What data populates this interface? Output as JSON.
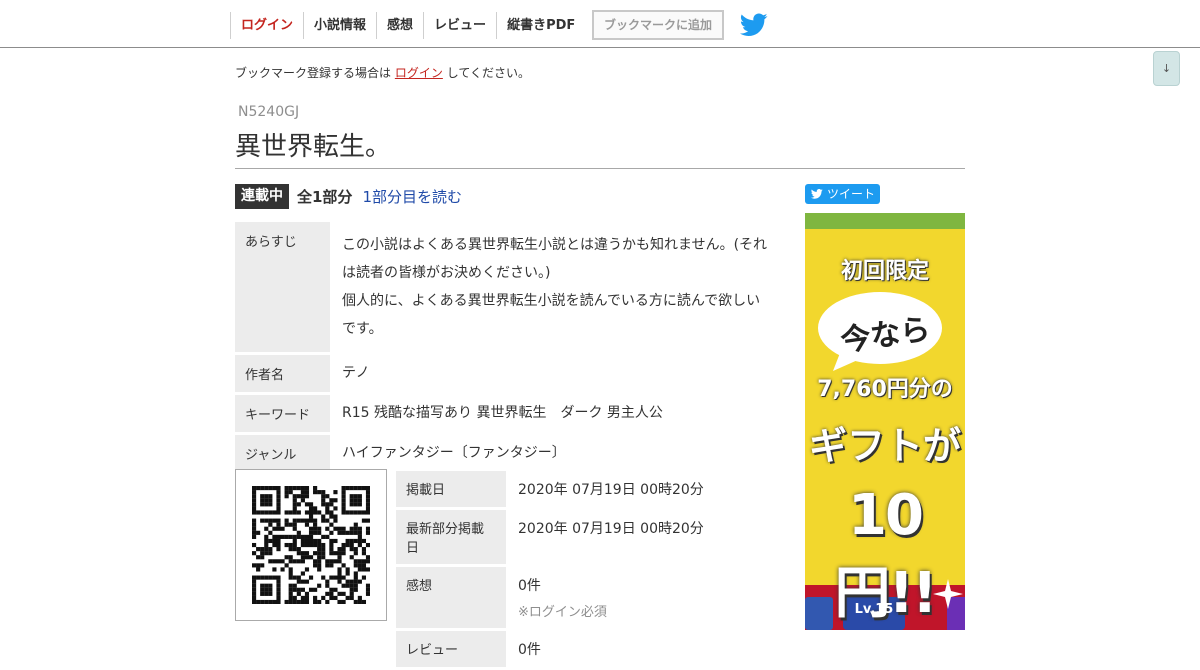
{
  "nav": {
    "login": "ログイン",
    "info": "小説情報",
    "impressions": "感想",
    "review": "レビュー",
    "pdf": "縦書きPDF",
    "bookmark_button": "ブックマークに追加",
    "twitter_icon": "twitter-icon"
  },
  "scroll_button": "↓",
  "bookmark_note": {
    "before": "ブックマーク登録する場合は",
    "link": "ログイン",
    "after": "してください。"
  },
  "novel": {
    "ncode": "N5240GJ",
    "title": "異世界転生。",
    "status": "連載中",
    "parts": "全1部分",
    "read_link": "1部分目を読む"
  },
  "info_rows": [
    {
      "label": "あらすじ",
      "value_lines": [
        "この小説はよくある異世界転生小説とは違うかも知れません。(それ",
        "は読者の皆様がお決めください。)",
        "個人的に、よくある異世界転生小説を読んでいる方に読んで欲しい",
        "です。"
      ]
    },
    {
      "label": "作者名",
      "value": "テノ"
    },
    {
      "label": "キーワード",
      "value": "R15 残酷な描写あり 異世界転生　ダーク 男主人公"
    },
    {
      "label": "ジャンル",
      "value": "ハイファンタジー〔ファンタジー〕"
    }
  ],
  "date_rows": [
    {
      "label": "掲載日",
      "value": "2020年 07月19日 00時20分"
    },
    {
      "label": "最新部分掲載日",
      "value": "2020年 07月19日 00時20分"
    },
    {
      "label": "感想",
      "value": "0件",
      "note": "※ログイン必須"
    },
    {
      "label": "レビュー",
      "value": "0件"
    }
  ],
  "tweet_button": "ツイート",
  "ad": {
    "line1": "初回限定",
    "line2": "今なら",
    "line3": "7,760円分の",
    "line4": "ギフトが",
    "line5": "10円!!",
    "badge": "Lv.15"
  },
  "colors": {
    "accent_red": "#c4251f",
    "link_blue": "#1f4aa8",
    "twitter_blue": "#1d9bf0",
    "label_bg": "#ececec",
    "ad_yellow": "#f2d72d"
  }
}
